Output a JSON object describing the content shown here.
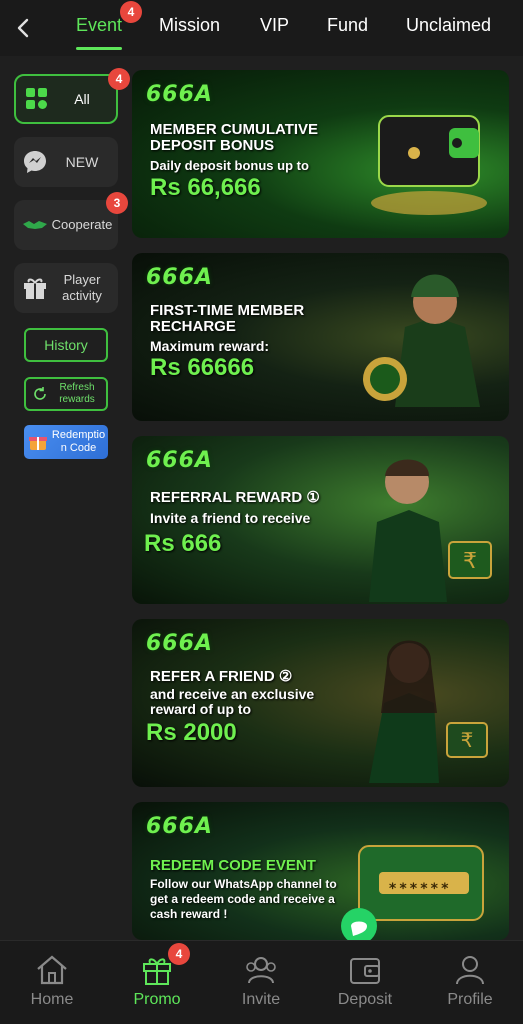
{
  "header": {
    "tabs": [
      {
        "label": "Event",
        "badge": "4"
      },
      {
        "label": "Mission"
      },
      {
        "label": "VIP"
      },
      {
        "label": "Fund"
      },
      {
        "label": "Unclaimed"
      }
    ],
    "active_tab": "Event"
  },
  "sidebar": {
    "items": [
      {
        "label": "All",
        "badge": "4",
        "icon": "grid-icon"
      },
      {
        "label": "NEW",
        "icon": "chat-bolt-icon"
      },
      {
        "label": "Cooperate",
        "badge": "3",
        "icon": "handshake-icon"
      },
      {
        "label": "Player activity",
        "icon": "gift-icon"
      }
    ],
    "history_label": "History",
    "refresh_label": "Refresh rewards",
    "redemption_label": "Redemption Code"
  },
  "banners": [
    {
      "logo": "666A",
      "title": "MEMBER CUMULATIVE DEPOSIT BONUS",
      "subtitle": "Daily deposit bonus up to",
      "amount": "Rs 66,666"
    },
    {
      "logo": "666A",
      "title": "FIRST-TIME MEMBER RECHARGE",
      "subtitle": "Maximum reward:",
      "amount": "Rs 66666"
    },
    {
      "logo": "666A",
      "title": "REFERRAL REWARD ①",
      "subtitle": "Invite a friend to receive",
      "amount": "Rs 666"
    },
    {
      "logo": "666A",
      "title": "REFER A FRIEND ②",
      "subtitle": "and receive an exclusive reward of up to",
      "amount": "Rs 2000"
    },
    {
      "logo": "666A",
      "title": "REDEEM CODE EVENT",
      "subtitle": "Follow our WhatsApp channel to get a redeem code and receive a cash reward !",
      "code_mask": "******"
    }
  ],
  "bottom_nav": {
    "items": [
      {
        "label": "Home",
        "icon": "home-icon"
      },
      {
        "label": "Promo",
        "icon": "gift-icon",
        "badge": "4"
      },
      {
        "label": "Invite",
        "icon": "invite-icon"
      },
      {
        "label": "Deposit",
        "icon": "wallet-icon"
      },
      {
        "label": "Profile",
        "icon": "profile-icon"
      }
    ],
    "active": "Promo"
  },
  "colors": {
    "accent": "#5ee65a",
    "badge": "#e8473d",
    "background": "#1f1f1f"
  }
}
